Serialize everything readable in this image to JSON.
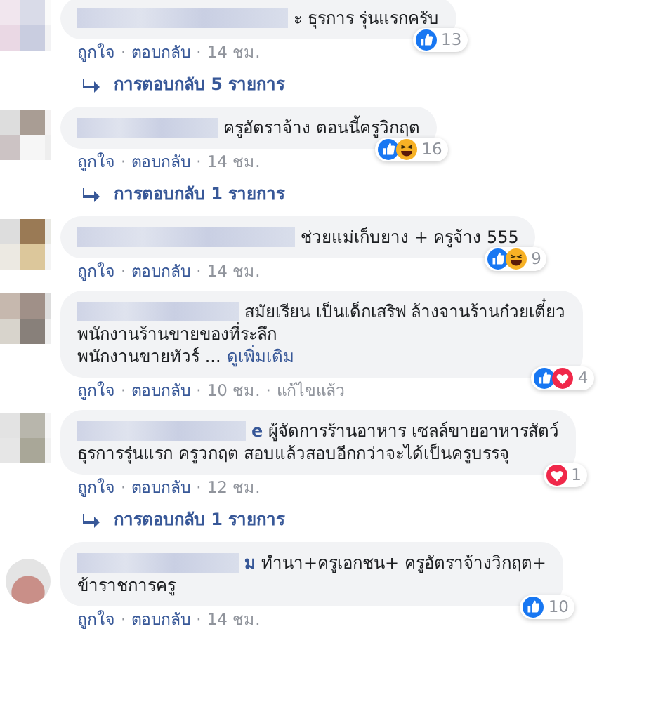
{
  "separator": "·",
  "comments": [
    {
      "avatar": {
        "kind": "mosaic"
      },
      "lines": [
        "ะ ธุรการ รุ่นแรกครับ"
      ],
      "reactions": [
        {
          "kind": "like"
        }
      ],
      "reaction_count": "13",
      "meta": [
        {
          "kind": "link",
          "text": "ถูกใจ"
        },
        {
          "kind": "link",
          "text": "ตอบกลับ"
        },
        {
          "kind": "time",
          "text": "14 ชม."
        }
      ],
      "replies": "การตอบกลับ 5 รายการ"
    },
    {
      "avatar": {
        "kind": "mosaic"
      },
      "lines": [
        "ครูอัตราจ้าง ตอนนี้ครูวิกฤต"
      ],
      "reactions": [
        {
          "kind": "like"
        },
        {
          "kind": "haha"
        }
      ],
      "reaction_count": "16",
      "meta": [
        {
          "kind": "link",
          "text": "ถูกใจ"
        },
        {
          "kind": "link",
          "text": "ตอบกลับ"
        },
        {
          "kind": "time",
          "text": "14 ชม."
        }
      ],
      "replies": "การตอบกลับ 1 รายการ"
    },
    {
      "avatar": {
        "kind": "mosaic"
      },
      "lines": [
        "ช่วยแม่เก็บยาง + ครูจ้าง 555"
      ],
      "reactions": [
        {
          "kind": "like"
        },
        {
          "kind": "haha"
        }
      ],
      "reaction_count": "9",
      "meta": [
        {
          "kind": "link",
          "text": "ถูกใจ"
        },
        {
          "kind": "link",
          "text": "ตอบกลับ"
        },
        {
          "kind": "time",
          "text": "14 ชม."
        }
      ]
    },
    {
      "avatar": {
        "kind": "mosaic"
      },
      "lines": [
        "สมัยเรียน เป็นเด็กเสริฟ ล้างจานร้านก๋วยเตี๋ยว",
        "พนักงานร้านขายของที่ระลึก",
        "พนักงานขายทัวร์ ..."
      ],
      "see_more": "ดูเพิ่มเติม",
      "reactions": [
        {
          "kind": "like"
        },
        {
          "kind": "love"
        }
      ],
      "reaction_count": "4",
      "meta": [
        {
          "kind": "link",
          "text": "ถูกใจ"
        },
        {
          "kind": "link",
          "text": "ตอบกลับ"
        },
        {
          "kind": "time",
          "text": "10 ชม."
        },
        {
          "kind": "time",
          "text": "แก้ไขแล้ว"
        }
      ]
    },
    {
      "avatar": {
        "kind": "mosaic"
      },
      "name_fragment": "e",
      "lines": [
        "ผู้จัดการร้านอาหาร เซลล์ขายอาหารสัตว์",
        "ธุรการรุ่นแรก ครูวกฤต สอบแล้วสอบอีกกว่าจะได้เป็นครูบรรจุ"
      ],
      "reactions": [
        {
          "kind": "love"
        }
      ],
      "reaction_count": "1",
      "meta": [
        {
          "kind": "link",
          "text": "ถูกใจ"
        },
        {
          "kind": "link",
          "text": "ตอบกลับ"
        },
        {
          "kind": "time",
          "text": "12 ชม."
        }
      ],
      "replies": "การตอบกลับ 1 รายการ"
    },
    {
      "avatar": {
        "kind": "round"
      },
      "name_fragment": "ม",
      "lines": [
        "ทำนา+ครูเอกชน+ ครูอัตราจ้างวิกฤต+",
        "ข้าราชการครู"
      ],
      "reactions": [
        {
          "kind": "like"
        }
      ],
      "reaction_count": "10",
      "meta": [
        {
          "kind": "link",
          "text": "ถูกใจ"
        },
        {
          "kind": "link",
          "text": "ตอบกลับ"
        },
        {
          "kind": "time",
          "text": "14 ชม."
        }
      ]
    }
  ]
}
